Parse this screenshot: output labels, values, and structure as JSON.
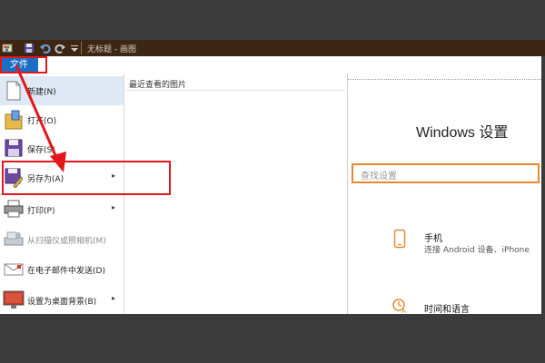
{
  "window": {
    "title": "无标题 - 画图"
  },
  "ribbon": {
    "file_tab": "文件"
  },
  "file_menu": {
    "items": [
      {
        "label": "新建(N)",
        "icon": "new-file-icon",
        "submenu": false,
        "disabled": false,
        "active": true
      },
      {
        "label": "打开(O)",
        "icon": "open-folder-icon",
        "submenu": false,
        "disabled": false,
        "active": false
      },
      {
        "label": "保存(S)",
        "icon": "save-icon",
        "submenu": false,
        "disabled": false,
        "active": false
      },
      {
        "label": "另存为(A)",
        "icon": "save-as-icon",
        "submenu": true,
        "disabled": false,
        "active": false
      },
      {
        "label": "打印(P)",
        "icon": "printer-icon",
        "submenu": true,
        "disabled": false,
        "active": false
      },
      {
        "label": "从扫描仪或照相机(M)",
        "icon": "scanner-icon",
        "submenu": false,
        "disabled": true,
        "active": false
      },
      {
        "label": "在电子邮件中发送(D)",
        "icon": "email-icon",
        "submenu": false,
        "disabled": false,
        "active": false
      },
      {
        "label": "设置为桌面背景(B)",
        "icon": "desktop-background-icon",
        "submenu": true,
        "disabled": false,
        "active": false
      }
    ]
  },
  "recent": {
    "header": "最近查看的图片"
  },
  "canvas": {
    "settings_title": "Windows 设置",
    "search_placeholder": "查找设置",
    "items": [
      {
        "title": "手机",
        "desc": "连接 Android 设备、iPhone",
        "icon": "phone-icon"
      },
      {
        "title": "时间和语言",
        "desc": "",
        "icon": "time-language-icon"
      }
    ]
  },
  "colors": {
    "file_tab": "#1a6fc2",
    "annotation": "#e3161b",
    "search_border": "#e48a2c",
    "titlebar": "#3d2714"
  }
}
